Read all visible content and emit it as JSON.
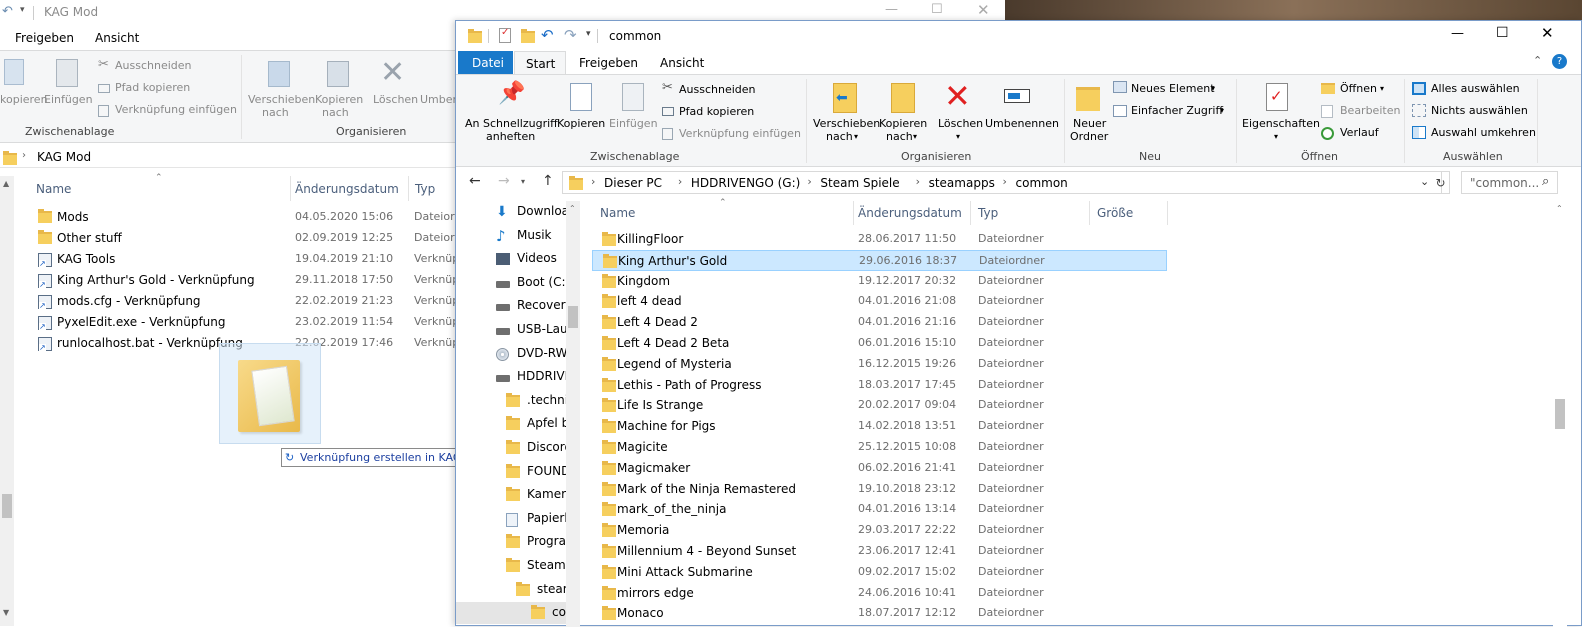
{
  "left_window": {
    "title": "KAG Mod",
    "tabs": [
      "Freigeben",
      "Ansicht"
    ],
    "ribbon": {
      "kopieren_partial": "kopieren",
      "einfuegen": "Einfügen",
      "ausschneiden": "Ausschneiden",
      "pfad_kopieren": "Pfad kopieren",
      "verknuepfung_einfuegen": "Verknüpfung einfügen",
      "zwischenablage": "Zwischenablage",
      "verschieben": "Verschieben",
      "verschieben2": "nach",
      "kopieren": "Kopieren",
      "kopieren2": "nach",
      "loeschen": "Löschen",
      "umbenennen_partial": "Umben",
      "organisieren": "Organisieren"
    },
    "address": "KAG Mod",
    "columns": {
      "name": "Name",
      "date": "Änderungsdatum",
      "type": "Typ"
    },
    "files": [
      {
        "name": "Mods",
        "date": "04.05.2020 15:06",
        "type": "Dateiord",
        "icon": "folder-icon"
      },
      {
        "name": "Other stuff",
        "date": "02.09.2019 12:25",
        "type": "Dateiord",
        "icon": "folder-icon"
      },
      {
        "name": "KAG Tools",
        "date": "19.04.2019 21:10",
        "type": "Verknüp",
        "icon": "shortcut-icon"
      },
      {
        "name": "King Arthur's Gold - Verknüpfung",
        "date": "29.11.2018 17:50",
        "type": "Verknüp",
        "icon": "shortcut-icon"
      },
      {
        "name": "mods.cfg - Verknüpfung",
        "date": "22.02.2019 21:23",
        "type": "Verknüp",
        "icon": "shortcut-icon"
      },
      {
        "name": "PyxelEdit.exe - Verknüpfung",
        "date": "23.02.2019 11:54",
        "type": "Verknüp",
        "icon": "shortcut-icon"
      },
      {
        "name": "runlocalhost.bat - Verknüpfung",
        "date": "22.02.2019 17:46",
        "type": "Verknüp",
        "icon": "shortcut-icon"
      }
    ],
    "drag_tooltip": "Verknüpfung erstellen in KAG Mod"
  },
  "right_window": {
    "title": "common",
    "tabs": [
      "Datei",
      "Start",
      "Freigeben",
      "Ansicht"
    ],
    "ribbon": {
      "schnellzugriff1": "An Schnellzugriff",
      "schnellzugriff2": "anheften",
      "kopieren": "Kopieren",
      "einfuegen": "Einfügen",
      "ausschneiden": "Ausschneiden",
      "pfad_kopieren": "Pfad kopieren",
      "verknuepfung_einfuegen": "Verknüpfung einfügen",
      "zwischenablage": "Zwischenablage",
      "verschieben1": "Verschieben",
      "verschieben2": "nach",
      "kopieren_nach1": "Kopieren",
      "kopieren_nach2": "nach",
      "loeschen": "Löschen",
      "umbenennen": "Umbenennen",
      "organisieren": "Organisieren",
      "neuer1": "Neuer",
      "neuer2": "Ordner",
      "neues_element": "Neues Element",
      "einfacher_zugriff": "Einfacher Zugriff",
      "neu": "Neu",
      "eigenschaften": "Eigenschaften",
      "oeffnen": "Öffnen",
      "bearbeiten": "Bearbeiten",
      "verlauf": "Verlauf",
      "oeffnen_group": "Öffnen",
      "alles_auswaehlen": "Alles auswählen",
      "nichts_auswaehlen": "Nichts auswählen",
      "auswahl_umkehren": "Auswahl umkehren",
      "auswaehlen": "Auswählen"
    },
    "breadcrumb": [
      "Dieser PC",
      "HDDRIVENGO (G:)",
      "Steam Spiele",
      "steamapps",
      "common"
    ],
    "search_placeholder": "\"common...",
    "nav": [
      {
        "label": "Downloa",
        "icon": "download-icon"
      },
      {
        "label": "Musik",
        "icon": "music-icon"
      },
      {
        "label": "Videos",
        "icon": "video-icon"
      },
      {
        "label": "Boot (C:)",
        "icon": "drive-icon"
      },
      {
        "label": "Recover",
        "icon": "drive-icon"
      },
      {
        "label": "USB-Lau",
        "icon": "drive-icon"
      },
      {
        "label": "DVD-RW",
        "icon": "dvd-icon"
      },
      {
        "label": "HDDRIVE",
        "icon": "drive-icon"
      },
      {
        "label": ".techni",
        "icon": "folder-icon"
      },
      {
        "label": "Apfel b",
        "icon": "folder-icon"
      },
      {
        "label": "Discord",
        "icon": "folder-icon"
      },
      {
        "label": "FOUND",
        "icon": "folder-icon"
      },
      {
        "label": "Kamera",
        "icon": "folder-icon"
      },
      {
        "label": "Papierk",
        "icon": "recycle-icon"
      },
      {
        "label": "Progran",
        "icon": "folder-icon"
      },
      {
        "label": "Steam S",
        "icon": "folder-icon"
      },
      {
        "label": "steam",
        "icon": "folder-icon"
      },
      {
        "label": "comm",
        "icon": "folder-icon"
      }
    ],
    "columns": {
      "name": "Name",
      "date": "Änderungsdatum",
      "type": "Typ",
      "size": "Größe"
    },
    "files": [
      {
        "name": "KillingFloor",
        "date": "28.06.2017 11:50",
        "type": "Dateiordner"
      },
      {
        "name": "King Arthur's Gold",
        "date": "29.06.2016 18:37",
        "type": "Dateiordner"
      },
      {
        "name": "Kingdom",
        "date": "19.12.2017 20:32",
        "type": "Dateiordner"
      },
      {
        "name": "left 4 dead",
        "date": "04.01.2016 21:08",
        "type": "Dateiordner"
      },
      {
        "name": "Left 4 Dead 2",
        "date": "04.01.2016 21:16",
        "type": "Dateiordner"
      },
      {
        "name": "Left 4 Dead 2 Beta",
        "date": "06.01.2016 15:10",
        "type": "Dateiordner"
      },
      {
        "name": "Legend of Mysteria",
        "date": "16.12.2015 19:26",
        "type": "Dateiordner"
      },
      {
        "name": "Lethis - Path of Progress",
        "date": "18.03.2017 17:45",
        "type": "Dateiordner"
      },
      {
        "name": "Life Is Strange",
        "date": "20.02.2017 09:04",
        "type": "Dateiordner"
      },
      {
        "name": "Machine for Pigs",
        "date": "14.02.2018 13:51",
        "type": "Dateiordner"
      },
      {
        "name": "Magicite",
        "date": "25.12.2015 10:08",
        "type": "Dateiordner"
      },
      {
        "name": "Magicmaker",
        "date": "06.02.2016 21:41",
        "type": "Dateiordner"
      },
      {
        "name": "Mark of the Ninja Remastered",
        "date": "19.10.2018 23:12",
        "type": "Dateiordner"
      },
      {
        "name": "mark_of_the_ninja",
        "date": "04.01.2016 13:14",
        "type": "Dateiordner"
      },
      {
        "name": "Memoria",
        "date": "29.03.2017 22:22",
        "type": "Dateiordner"
      },
      {
        "name": "Millennium 4 - Beyond Sunset",
        "date": "23.06.2017 12:41",
        "type": "Dateiordner"
      },
      {
        "name": "Mini Attack Submarine",
        "date": "09.02.2017 15:02",
        "type": "Dateiordner"
      },
      {
        "name": "mirrors edge",
        "date": "24.06.2016 10:41",
        "type": "Dateiordner"
      },
      {
        "name": "Monaco",
        "date": "18.07.2017 12:12",
        "type": "Dateiordner"
      }
    ],
    "selected_index": 1
  },
  "colors": {
    "accent": "#1979ca",
    "selection_bg": "#cce8ff",
    "selection_border": "#99d1ff",
    "folder": "#f6cf5e"
  }
}
